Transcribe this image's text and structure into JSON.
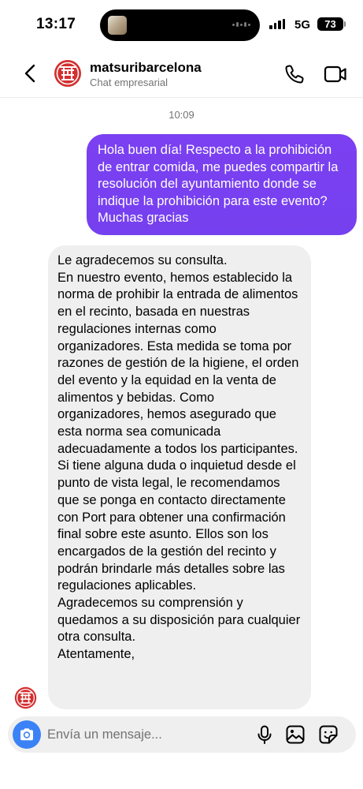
{
  "status_bar": {
    "time": "13:17",
    "network": "5G",
    "battery": "73"
  },
  "header": {
    "name": "matsuribarcelona",
    "subtitle": "Chat empresarial",
    "icons": [
      "back-chevron",
      "phone",
      "video-camera"
    ]
  },
  "chat": {
    "timestamp": "10:09",
    "messages": [
      {
        "direction": "outgoing",
        "text": "Hola buen día! Respecto a la prohibición de entrar comida, me puedes compartir la resolución del ayuntamiento donde se indique la prohibición para este evento? Muchas gracias"
      },
      {
        "direction": "incoming",
        "paragraphs": [
          "Le agradecemos su consulta.",
          "En nuestro evento, hemos establecido la norma de prohibir la entrada de alimentos en el recinto, basada en nuestras regulaciones internas como organizadores. Esta medida se toma por razones de gestión de la higiene, el orden del evento y la equidad en la venta de alimentos y bebidas. Como organizadores, hemos asegurado que esta norma sea comunicada adecuadamente a todos los participantes.",
          "Si tiene alguna duda o inquietud desde el punto de vista legal, le recomendamos que se ponga en contacto directamente con Port para obtener una confirmación final sobre este asunto. Ellos son los encargados de la gestión del recinto y podrán brindarle más detalles sobre las regulaciones aplicables.",
          "Agradecemos su comprensión y quedamos a su disposición para cualquier otra consulta.",
          "Atentamente,"
        ]
      }
    ]
  },
  "composer": {
    "placeholder": "Envía un mensaje...",
    "icons": [
      "camera",
      "microphone",
      "gallery",
      "sticker"
    ]
  },
  "colors": {
    "outgoing_bubble": "#7a40f0",
    "incoming_bubble": "#efefef",
    "camera_button": "#3b82f6",
    "brand_red": "#d32f2f"
  }
}
